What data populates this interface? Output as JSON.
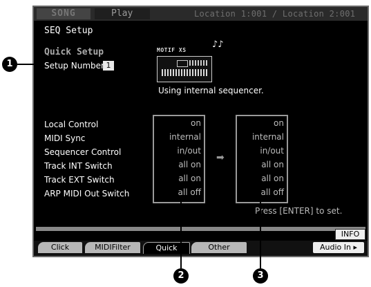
{
  "header": {
    "tab_song": "SONG",
    "tab_play": "Play",
    "location": "Location 1:001 / Location 2:001"
  },
  "page_title": "SEQ Setup",
  "quick_setup": {
    "label": "Quick Setup",
    "setup_number_label": "Setup Number",
    "setup_number_value": "1",
    "motif_logo": "MOTIF XS",
    "notes": "♪♪",
    "status": "Using internal sequencer."
  },
  "settings": {
    "labels": [
      "Local Control",
      "MIDI Sync",
      "Sequencer Control",
      "Track INT Switch",
      "Track EXT Switch",
      "ARP MIDI Out Switch"
    ],
    "current": [
      "on",
      "internal",
      "in/out",
      "all on",
      "all on",
      "all off"
    ],
    "target": [
      "on",
      "internal",
      "in/out",
      "all on",
      "all on",
      "all off"
    ]
  },
  "arrow": "➡",
  "hint": "Press [ENTER] to set.",
  "info_button": "INFO",
  "tabs": [
    "Click",
    "MIDIFilter",
    "Quick",
    "Other",
    "Audio In ▸"
  ],
  "callouts": [
    "1",
    "2",
    "3"
  ]
}
